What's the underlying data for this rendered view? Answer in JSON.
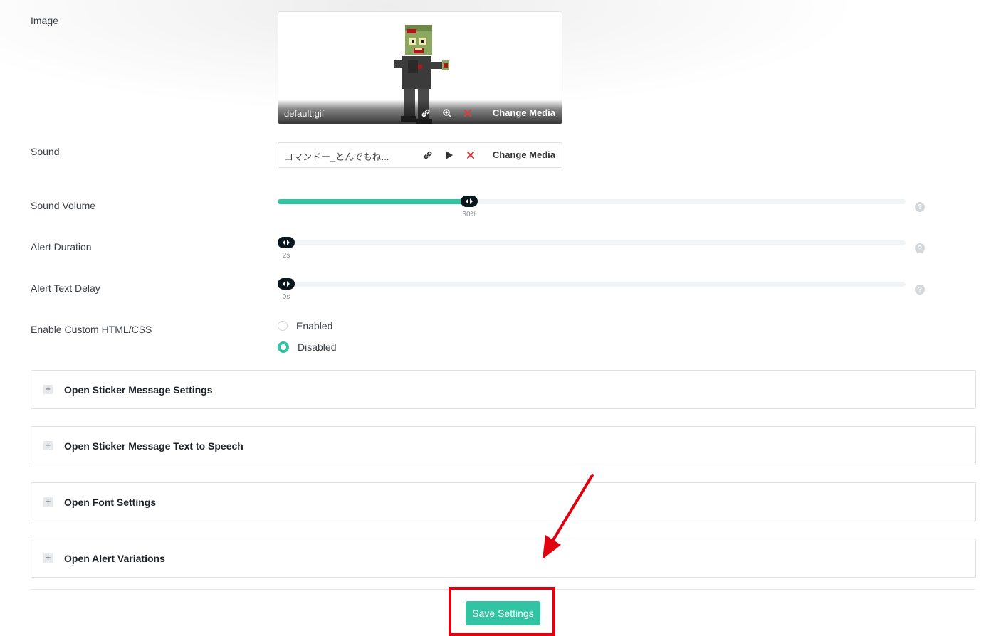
{
  "image": {
    "label": "Image",
    "file_name": "default.gif",
    "change_label": "Change Media",
    "icons": [
      "link-icon",
      "zoom-icon",
      "remove-icon"
    ]
  },
  "sound": {
    "label": "Sound",
    "file_name": "コマンドー_とんでもね...",
    "change_label": "Change Media",
    "icons": [
      "link-icon",
      "play-icon",
      "remove-icon"
    ]
  },
  "sliders": {
    "sound_volume": {
      "label": "Sound Volume",
      "value_text": "30%",
      "fraction": 0.3
    },
    "alert_duration": {
      "label": "Alert Duration",
      "value_text": "2s",
      "fraction": 0.0
    },
    "alert_text_delay": {
      "label": "Alert Text Delay",
      "value_text": "0s",
      "fraction": 0.0
    },
    "help_glyph": "?"
  },
  "custom_html": {
    "label": "Enable Custom HTML/CSS",
    "options": [
      {
        "label": "Enabled",
        "selected": false
      },
      {
        "label": "Disabled",
        "selected": true
      }
    ]
  },
  "accordions": [
    {
      "title": "Open Sticker Message Settings"
    },
    {
      "title": "Open Sticker Message Text to Speech"
    },
    {
      "title": "Open Font Settings"
    },
    {
      "title": "Open Alert Variations"
    }
  ],
  "accordion_expand_glyph": "+",
  "save_button": {
    "label": "Save Settings"
  },
  "colors": {
    "accent": "#31c3a2",
    "handle": "#09161d",
    "annotation": "#e0000f",
    "remove": "#e03b3b"
  }
}
